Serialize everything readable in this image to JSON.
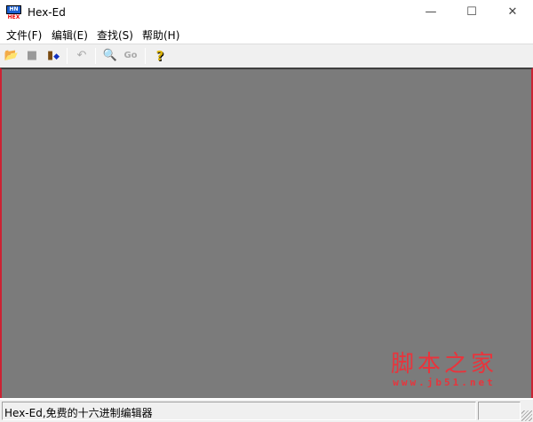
{
  "window": {
    "title": "Hex-Ed",
    "icon_top": "HN",
    "icon_bottom": "HEX"
  },
  "controls": {
    "minimize": "—",
    "maximize": "☐",
    "close": "✕"
  },
  "menu": [
    "文件(F)",
    "编辑(E)",
    "查找(S)",
    "帮助(H)"
  ],
  "toolbar": {
    "open": "open-folder-icon",
    "save": "save-icon",
    "exit": "exit-door-icon",
    "undo": "undo-icon",
    "find": "find-icon",
    "goto": "Go",
    "help": "?"
  },
  "status": {
    "text": "Hex-Ed,免费的十六进制编辑器"
  },
  "watermark": {
    "title": "脚本之家",
    "url": "www.jb51.net"
  }
}
